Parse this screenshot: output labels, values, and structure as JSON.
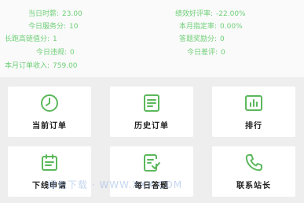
{
  "stats": {
    "today_duration": {
      "label": "当日时薪:",
      "value": "23.00"
    },
    "performance_rate": {
      "label": "绩效好评率:",
      "value": "-22.00%"
    },
    "today_services": {
      "label": "今日服务分:",
      "value": "10"
    },
    "month_designated_rate": {
      "label": "本月指定率:",
      "value": "0.00%"
    },
    "station_master_value": {
      "label": "长跑高链值分:",
      "value": "1"
    },
    "quiz_reward": {
      "label": "答题奖励分:",
      "value": "0"
    },
    "today_late": {
      "label": "今日违规:",
      "value": "0"
    },
    "today_bad_review": {
      "label": "今日差评:",
      "value": "0"
    },
    "month_order_income": {
      "label": "本月订单收入:",
      "value": "759.00"
    }
  },
  "tiles": [
    {
      "label": "当前订单",
      "icon": "clock-icon"
    },
    {
      "label": "历史订单",
      "icon": "document-list-icon"
    },
    {
      "label": "排行",
      "icon": "bar-chart-icon"
    },
    {
      "label": "下线申请",
      "icon": "calendar-icon"
    },
    {
      "label": "每日答题",
      "icon": "checklist-icon"
    },
    {
      "label": "联系站长",
      "icon": "phone-icon"
    }
  ],
  "watermark": "绿色下载 · WWW.XXX.COM",
  "colors": {
    "accent": "#5cb85c",
    "stat_text": "#6ecf77",
    "background": "#eeeeee",
    "tile": "#ffffff"
  }
}
